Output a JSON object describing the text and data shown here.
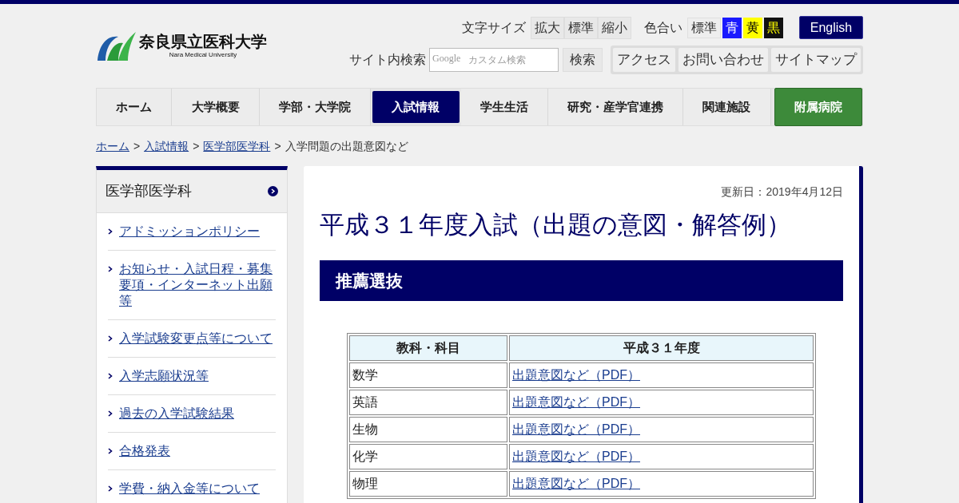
{
  "logo": {
    "name": "奈良県立医科大学",
    "subtitle": "Nara Medical University"
  },
  "font_size": {
    "label": "文字サイズ",
    "options": [
      "拡大",
      "標準",
      "縮小"
    ]
  },
  "color_scheme": {
    "label": "色合い",
    "options": [
      {
        "label": "標準",
        "kind": "standard"
      },
      {
        "label": "青",
        "kind": "blue"
      },
      {
        "label": "黄",
        "kind": "yellow"
      },
      {
        "label": "黒",
        "kind": "black"
      }
    ]
  },
  "language_button": "English",
  "search": {
    "label": "サイト内検索",
    "placeholder": "カスタム検索",
    "brand": "Google",
    "button": "検索"
  },
  "utility_links": [
    "アクセス",
    "お問い合わせ",
    "サイトマップ"
  ],
  "nav": [
    {
      "label": "ホーム",
      "selected": false,
      "kind": "normal"
    },
    {
      "label": "大学概要",
      "selected": false,
      "kind": "normal"
    },
    {
      "label": "学部・大学院",
      "selected": false,
      "kind": "normal"
    },
    {
      "label": "入試情報",
      "selected": true,
      "kind": "normal"
    },
    {
      "label": "学生生活",
      "selected": false,
      "kind": "normal"
    },
    {
      "label": "研究・産学官連携",
      "selected": false,
      "kind": "normal"
    },
    {
      "label": "関連施設",
      "selected": false,
      "kind": "normal"
    },
    {
      "label": "附属病院",
      "selected": false,
      "kind": "hospital"
    }
  ],
  "breadcrumb": {
    "links": [
      "ホーム",
      "入試情報",
      "医学部医学科"
    ],
    "separator": ">",
    "current": "入学問題の出題意図など"
  },
  "sidebar": {
    "heading": "医学部医学科",
    "items": [
      "アドミッションポリシー",
      "お知らせ・入試日程・募集要項・インターネット出願等",
      "入学試験変更点等について",
      "入学志願状況等",
      "過去の入学試験結果",
      "合格発表",
      "学費・納入金等について"
    ]
  },
  "main": {
    "updated": "更新日：2019年4月12日",
    "title": "平成３１年度入試（出題の意図・解答例）",
    "section": "推薦選抜",
    "table": {
      "columns": [
        "教科・科目",
        "平成３１年度"
      ],
      "rows": [
        [
          "数学",
          "出題意図など（PDF）"
        ],
        [
          "英語",
          "出題意図など（PDF）"
        ],
        [
          "生物",
          "出題意図など（PDF）"
        ],
        [
          "化学",
          "出題意図など（PDF）"
        ],
        [
          "物理",
          "出題意図など（PDF）"
        ]
      ]
    }
  }
}
